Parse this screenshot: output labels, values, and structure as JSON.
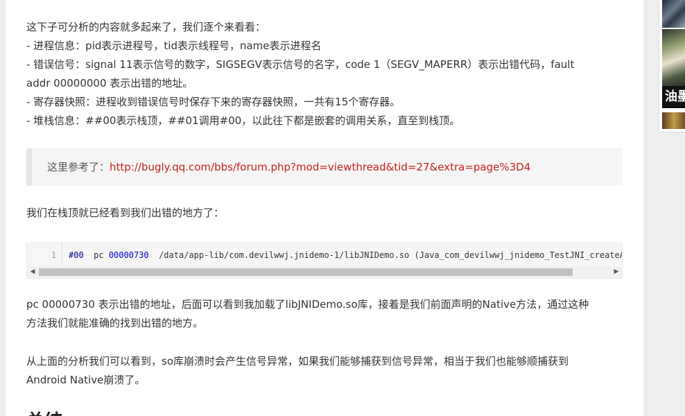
{
  "article": {
    "intro_lines": [
      "这下子可分析的内容就多起来了，我们逐个来看看：",
      "- 进程信息：pid表示进程号，tid表示线程号，name表示进程名",
      "- 错误信号：signal 11表示信号的数字，SIGSEGV表示信号的名字，code 1（SEGV_MAPERR）表示出错代码，fault",
      "addr 00000000 表示出错的地址。",
      "- 寄存器快照：进程收到错误信号时保存下来的寄存器快照，一共有15个寄存器。",
      "- 堆栈信息：##00表示栈顶，##01调用#00，以此往下都是嵌套的调用关系，直至到栈顶。"
    ],
    "quote_prefix": "这里参考了：",
    "quote_link": "http://bugly.qq.com/bbs/forum.php?mod=viewthread&tid=27&extra=page%3D4",
    "p2": "我们在栈顶就已经看到我们出错的地方了：",
    "code": {
      "line_number": "1",
      "frame": "#00",
      "pc_label": "pc",
      "address": "00000730",
      "path_and_symbol": "/data/app-lib/com.devilwwj.jnidemo-1/libJNIDemo.so (Java_com_devilwwj_jnidemo_TestJNI_createANat"
    },
    "p3_line1": "pc 00000730 表示出错的地址，后面可以看到我加载了libJNIDemo.so库，接着是我们前面声明的Native方法，通过这种",
    "p3_line2": "方法我们就能准确的找到出错的地方。",
    "p4_line1": "从上面的分析我们可以看到，so库崩溃时会产生信号异常，如果我们能够捕获到信号异常，相当于我们也能够顺捕获到",
    "p4_line2": "Android Native崩溃了。",
    "partial_heading": "总结"
  },
  "sidebar": {
    "thumb_caption": "油墨"
  },
  "icons": {
    "scroll_left": "triangle-left-icon",
    "scroll_right": "triangle-right-icon"
  },
  "colors": {
    "link": "#cc1f1f",
    "code_keyword": "#000080",
    "code_number": "#0000cc"
  }
}
